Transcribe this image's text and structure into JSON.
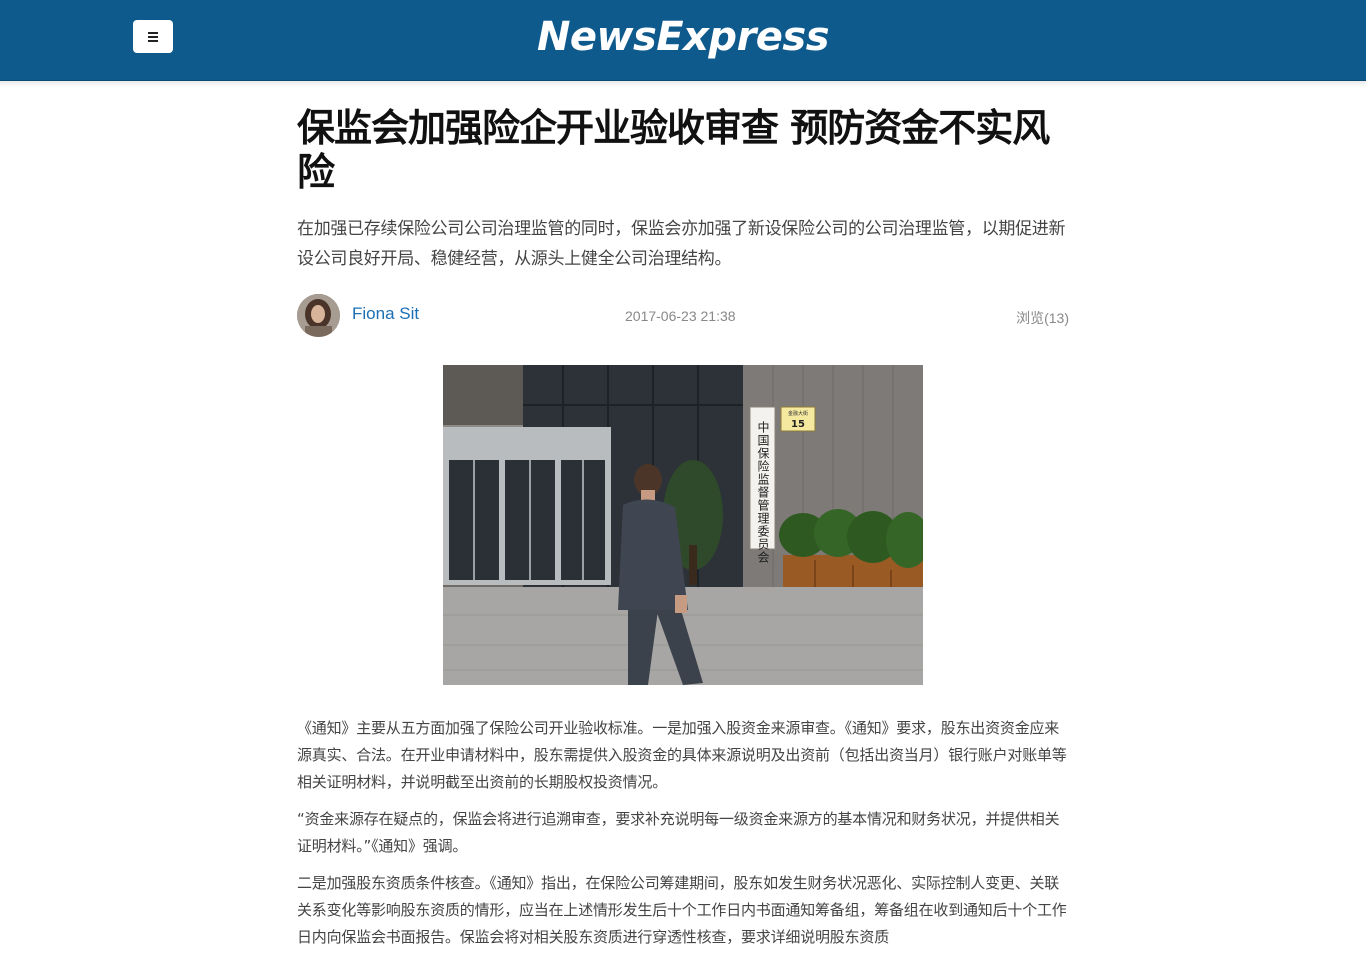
{
  "header": {
    "logo_text": "NewsExpress",
    "menu_icon": "hamburger-menu-icon",
    "brand_color": "#0f5a8d"
  },
  "article": {
    "headline": "保监会加强险企开业验收审查 预防资金不实风险",
    "summary": "在加强已存续保险公司公司治理监管的同时，保监会亦加强了新设保险公司的公司治理监管，以期促进新设公司良好开局、稳健经营，从源头上健全公司治理结构。",
    "author": "Fiona Sit",
    "date": "2017-06-23 21:38",
    "views": "浏览(13)",
    "image": {
      "sign_vertical_text": "中国保险监督管理委员会",
      "plate_street": "金融大街",
      "plate_number": "15"
    },
    "paragraphs": [
      "《通知》主要从五方面加强了保险公司开业验收标准。一是加强入股资金来源审查。《通知》要求，股东出资资金应来源真实、合法。在开业申请材料中，股东需提供入股资金的具体来源说明及出资前（包括出资当月）银行账户对账单等相关证明材料，并说明截至出资前的长期股权投资情况。",
      "“资金来源存在疑点的，保监会将进行追溯审查，要求补充说明每一级资金来源方的基本情况和财务状况，并提供相关证明材料。”《通知》强调。",
      "二是加强股东资质条件核查。《通知》指出，在保险公司筹建期间，股东如发生财务状况恶化、实际控制人变更、关联关系变化等影响股东资质的情形，应当在上述情形发生后十个工作日内书面通知筹备组，筹备组在收到通知后十个工作日内向保监会书面报告。保监会将对相关股东资质进行穿透性核查，要求详细说明股东资质"
    ]
  }
}
